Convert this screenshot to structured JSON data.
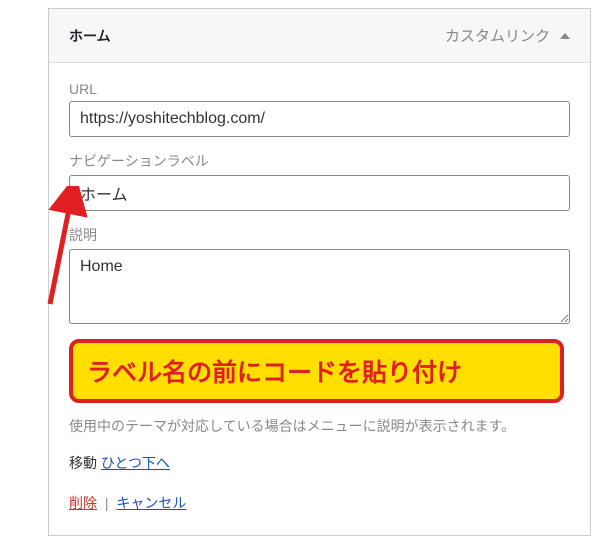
{
  "panel": {
    "title": "ホーム",
    "type_label": "カスタムリンク"
  },
  "fields": {
    "url_label": "URL",
    "url_value": "https://yoshitechblog.com/",
    "nav_label_label": "ナビゲーションラベル",
    "nav_label_value": "ホーム",
    "desc_label": "説明",
    "desc_value": "Home"
  },
  "callout": {
    "text": "ラベル名の前にコードを貼り付け"
  },
  "desc_note": "使用中のテーマが対応している場合はメニューに説明が表示されます。",
  "move": {
    "label": "移動",
    "down_link": "ひとつ下へ"
  },
  "actions": {
    "delete": "削除",
    "separator": "|",
    "cancel": "キャンセル"
  }
}
